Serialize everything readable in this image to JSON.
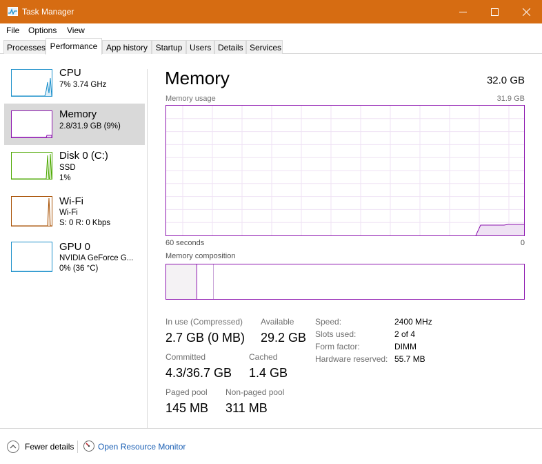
{
  "window": {
    "title": "Task Manager"
  },
  "menu": [
    "File",
    "Options",
    "View"
  ],
  "tabs": [
    "Processes",
    "Performance",
    "App history",
    "Startup",
    "Users",
    "Details",
    "Services"
  ],
  "active_tab": "Performance",
  "sidebar": {
    "items": [
      {
        "name": "CPU",
        "lines": [
          "7% 3.74 GHz"
        ],
        "color": "#1a8fca"
      },
      {
        "name": "Memory",
        "lines": [
          "2.8/31.9 GB (9%)"
        ],
        "color": "#8b12ae"
      },
      {
        "name": "Disk 0 (C:)",
        "lines": [
          "SSD",
          "1%"
        ],
        "color": "#4ca800"
      },
      {
        "name": "Wi-Fi",
        "lines": [
          "Wi-Fi",
          "S: 0 R: 0 Kbps"
        ],
        "color": "#a74f01"
      },
      {
        "name": "GPU 0",
        "lines": [
          "NVIDIA GeForce G...",
          "0% (36 °C)"
        ],
        "color": "#1a8fca"
      }
    ]
  },
  "memory": {
    "title": "Memory",
    "total": "32.0 GB",
    "usage_label": "Memory usage",
    "usage_max": "31.9 GB",
    "time_left": "60 seconds",
    "time_right": "0",
    "composition_label": "Memory composition",
    "stats": {
      "in_use_label": "In use (Compressed)",
      "in_use_value": "2.7 GB (0 MB)",
      "available_label": "Available",
      "available_value": "29.2 GB",
      "committed_label": "Committed",
      "committed_value": "4.3/36.7 GB",
      "cached_label": "Cached",
      "cached_value": "1.4 GB",
      "paged_label": "Paged pool",
      "paged_value": "145 MB",
      "nonpaged_label": "Non-paged pool",
      "nonpaged_value": "311 MB"
    },
    "details": [
      {
        "key": "Speed:",
        "value": "2400 MHz"
      },
      {
        "key": "Slots used:",
        "value": "2 of 4"
      },
      {
        "key": "Form factor:",
        "value": "DIMM"
      },
      {
        "key": "Hardware reserved:",
        "value": "55.7 MB"
      }
    ],
    "accent_color": "#8b12ae"
  },
  "footer": {
    "fewer_details": "Fewer details",
    "resource_monitor": "Open Resource Monitor"
  },
  "colors": {
    "titlebar": "#d66c12",
    "link": "#1a5fb4"
  }
}
